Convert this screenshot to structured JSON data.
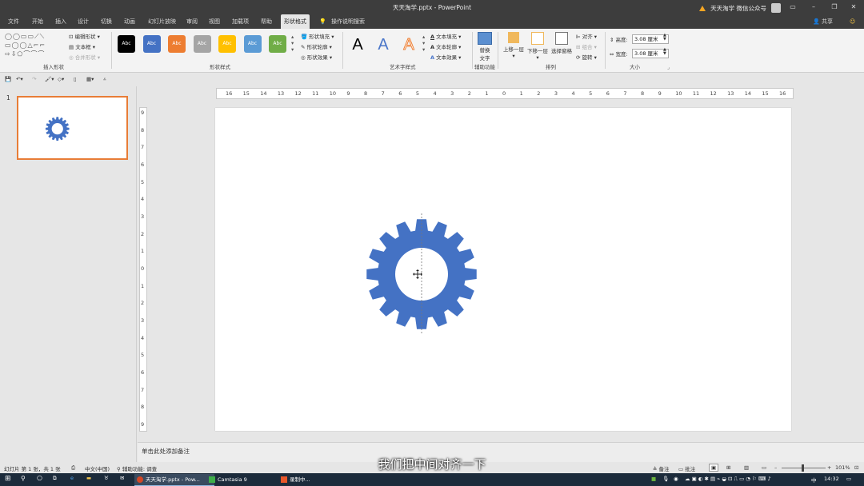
{
  "window": {
    "title": "天天淘学.pptx - PowerPoint",
    "user_label": "天天淘学 微信公众号",
    "share_label": "共享"
  },
  "menu": {
    "tabs": [
      "文件",
      "开始",
      "插入",
      "设计",
      "切换",
      "动画",
      "幻灯片放映",
      "审阅",
      "视图",
      "加载项",
      "帮助",
      "形状格式"
    ],
    "active": "形状格式",
    "search_label": "操作说明搜索"
  },
  "ribbon": {
    "insert_shapes": {
      "edit_shape": "编辑形状",
      "text_box": "文本框",
      "merge_shapes": "合并形状",
      "group_label": "插入形状"
    },
    "shape_styles": {
      "swatches": [
        {
          "label": "Abc",
          "color": "#000000"
        },
        {
          "label": "Abc",
          "color": "#4472c4"
        },
        {
          "label": "Abc",
          "color": "#ed7d31"
        },
        {
          "label": "Abc",
          "color": "#a5a5a5"
        },
        {
          "label": "Abc",
          "color": "#ffc000"
        },
        {
          "label": "Abc",
          "color": "#5b9bd5"
        },
        {
          "label": "Abc",
          "color": "#70ad47"
        }
      ],
      "fill": "形状填充",
      "outline": "形状轮廓",
      "effects": "形状效果",
      "group_label": "形状样式"
    },
    "wordart": {
      "samples": [
        "A",
        "A",
        "A"
      ],
      "text_fill": "文本填充",
      "text_outline": "文本轮廓",
      "text_effects": "文本效果",
      "group_label": "艺术字样式"
    },
    "accessibility": {
      "alt_text_line1": "替换",
      "alt_text_line2": "文字",
      "group_label": "辅助功能"
    },
    "arrange": {
      "bring_forward": "上移一层",
      "send_backward": "下移一层",
      "selection_pane": "选择窗格",
      "align": "对齐",
      "group": "组合",
      "rotate": "旋转",
      "group_label": "排列"
    },
    "size": {
      "height_label": "高度:",
      "height_value": "3.08 厘米",
      "width_label": "宽度:",
      "width_value": "3.08 厘米",
      "group_label": "大小"
    }
  },
  "slides_panel": {
    "slide_number": "1"
  },
  "rulers": {
    "horizontal_ticks": [
      "16",
      "15",
      "14",
      "13",
      "12",
      "11",
      "10",
      "9",
      "8",
      "7",
      "6",
      "5",
      "4",
      "3",
      "2",
      "1",
      "0",
      "1",
      "2",
      "3",
      "4",
      "5",
      "6",
      "7",
      "8",
      "9",
      "10",
      "11",
      "12",
      "13",
      "14",
      "15",
      "16"
    ],
    "vertical_ticks": [
      "9",
      "8",
      "7",
      "6",
      "5",
      "4",
      "3",
      "2",
      "1",
      "0",
      "1",
      "2",
      "3",
      "4",
      "5",
      "6",
      "7",
      "8",
      "9"
    ]
  },
  "notes": {
    "placeholder": "单击此处添加备注"
  },
  "status": {
    "slide_info": "幻灯片 第 1 张，共 1 张",
    "language": "中文(中国)",
    "accessibility": "辅助功能: 调查",
    "notes_btn": "备注",
    "comments_btn": "批注",
    "zoom": "101%"
  },
  "subtitle": "我们把中间对齐一下",
  "taskbar": {
    "tasks": [
      "天天淘学.pptx - Pow...",
      "Camtasia 9",
      "录制中..."
    ],
    "ime": "中",
    "clock": "14:32"
  }
}
